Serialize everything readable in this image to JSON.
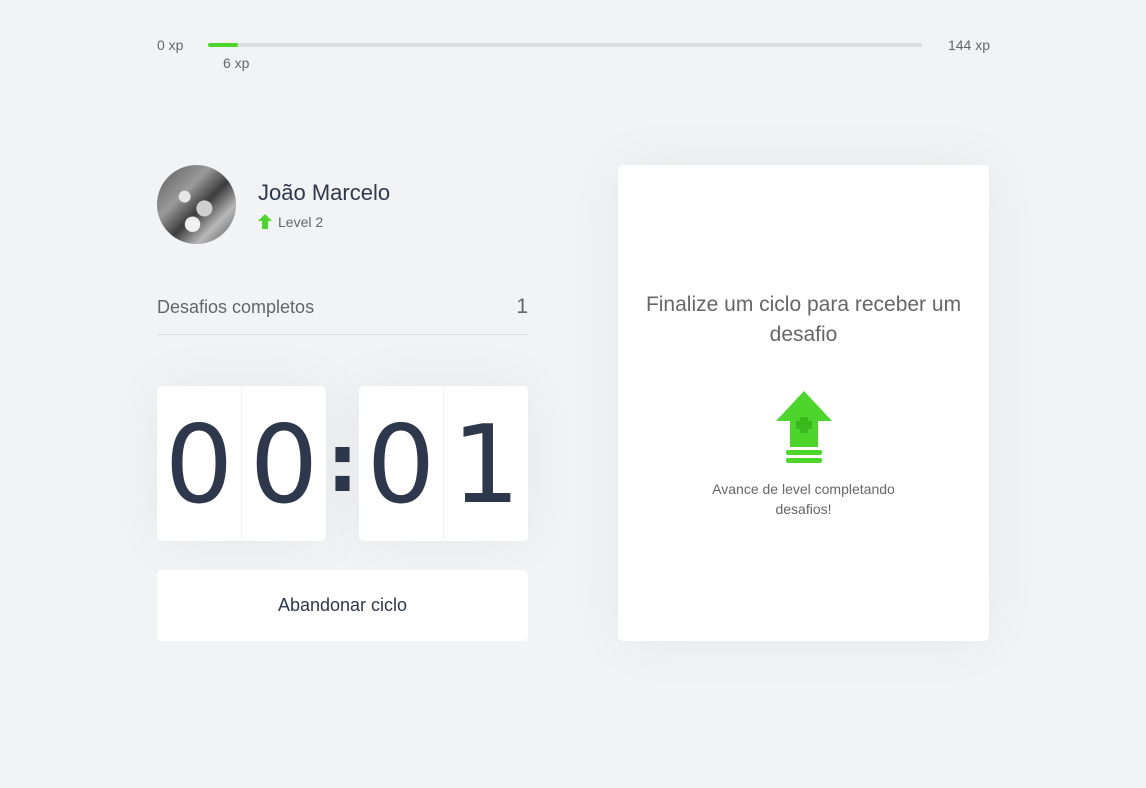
{
  "experience": {
    "min_label": "0 xp",
    "max_label": "144 xp",
    "current_label": "6 xp",
    "progress_fraction": 0.0417,
    "fill_color": "#4cd62b"
  },
  "profile": {
    "name": "João Marcelo",
    "level_label": "Level 2",
    "level_icon": "level-up-arrow-icon"
  },
  "completed_challenges": {
    "label": "Desafios completos",
    "count": "1"
  },
  "countdown": {
    "minute_left": "0",
    "minute_right": "0",
    "separator": ":",
    "second_left": "0",
    "second_right": "1"
  },
  "abandon_button": {
    "label": "Abandonar ciclo"
  },
  "challenge_box": {
    "title": "Finalize um ciclo para receber um desafio",
    "icon": "level-up-icon",
    "hint": "Avance de level completando desafios!"
  },
  "colors": {
    "accent_green": "#4cd62b",
    "text_dark": "#2e384d",
    "text_muted": "#666666",
    "background": "#f2f3f5"
  }
}
